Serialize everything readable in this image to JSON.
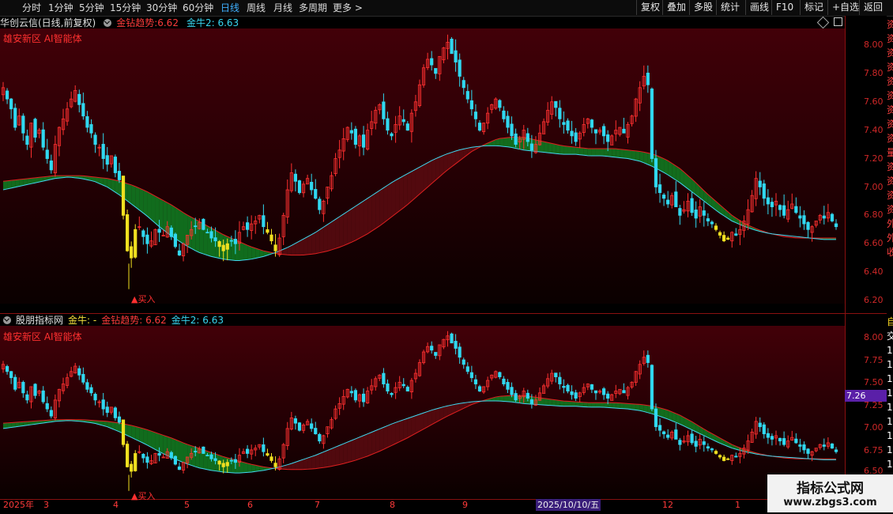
{
  "toolbar": {
    "periods": [
      "分时",
      "1分钟",
      "5分钟",
      "15分钟",
      "30分钟",
      "60分钟",
      "日线",
      "周线",
      "月线",
      "多周期",
      "更多 >"
    ],
    "active_period": "日线",
    "right_buttons": [
      "复权",
      "叠加",
      "多股",
      "统计",
      "画线",
      "F10",
      "标记",
      "+自选",
      "返回"
    ]
  },
  "panel1": {
    "stock": "华创云信(日线,前复权)",
    "ind_name": "金钻趋势:",
    "ind_value": "6.62",
    "ind2": "金牛2: 6.63",
    "tag": "雄安新区 AI智能体",
    "buy": "▲买入",
    "y_ticks": [
      "8.00",
      "7.80",
      "7.60",
      "7.40",
      "7.20",
      "7.00",
      "6.80",
      "6.60",
      "6.40",
      "6.20"
    ]
  },
  "panel2": {
    "source": "股朋指标网",
    "jn": "金牛: -",
    "ind": "金钻趋势: 6.62",
    "ind2": "金牛2: 6.63",
    "tag": "雄安新区 AI智能体",
    "buy": "▲买入",
    "y_ticks": [
      "8.00",
      "7.75",
      "7.50",
      "7.25",
      "7.00",
      "6.75",
      "6.50"
    ],
    "price_tag": "7.26"
  },
  "right_column": [
    "资",
    "资",
    "资",
    "资",
    "资",
    "资",
    "资",
    "资",
    "资",
    "量",
    "资",
    "资",
    "资",
    "资",
    "外",
    "外",
    "收"
  ],
  "right_column2": [
    "自",
    "交",
    "1",
    "1",
    "1",
    "1",
    "1",
    "1",
    "1",
    "1",
    "1",
    "1"
  ],
  "xaxis": [
    "2025年",
    "3",
    "4",
    "5",
    "6",
    "7",
    "8",
    "9",
    "2025/10/10/五",
    "12",
    "1"
  ],
  "watermark": {
    "title": "指标公式网",
    "url": "www.zbgs3.com"
  },
  "colors": {
    "up": "#ff3030",
    "down": "#30d8f0",
    "green": "#10a030",
    "yellow": "#f0e020",
    "bg_top": "#3c0008"
  },
  "chart_data": {
    "type": "candlestick",
    "ylim_top": [
      6.15,
      8.1
    ],
    "ylim_bottom": [
      6.45,
      8.1
    ],
    "closes": [
      7.7,
      7.62,
      7.55,
      7.42,
      7.5,
      7.38,
      7.3,
      7.45,
      7.35,
      7.4,
      7.28,
      7.2,
      7.12,
      7.3,
      7.42,
      7.48,
      7.55,
      7.62,
      7.68,
      7.58,
      7.5,
      7.42,
      7.38,
      7.3,
      7.28,
      7.2,
      7.16,
      7.22,
      7.1,
      7.05,
      6.8,
      6.55,
      6.5,
      6.7,
      6.72,
      6.65,
      6.6,
      6.62,
      6.7,
      6.68,
      6.66,
      6.72,
      6.65,
      6.58,
      6.52,
      6.6,
      6.66,
      6.7,
      6.72,
      6.75,
      6.7,
      6.68,
      6.64,
      6.62,
      6.58,
      6.55,
      6.6,
      6.62,
      6.6,
      6.68,
      6.72,
      6.7,
      6.74,
      6.76,
      6.8,
      6.72,
      6.68,
      6.62,
      6.55,
      6.64,
      6.8,
      6.98,
      7.1,
      7.04,
      6.96,
      7.02,
      7.06,
      6.98,
      6.92,
      6.84,
      6.9,
      7.0,
      7.08,
      7.2,
      7.26,
      7.34,
      7.42,
      7.38,
      7.3,
      7.36,
      7.28,
      7.4,
      7.46,
      7.54,
      7.58,
      7.48,
      7.4,
      7.36,
      7.44,
      7.5,
      7.46,
      7.4,
      7.52,
      7.6,
      7.72,
      7.84,
      7.9,
      7.86,
      7.8,
      7.92,
      7.98,
      8.02,
      7.94,
      7.88,
      7.78,
      7.7,
      7.62,
      7.55,
      7.48,
      7.4,
      7.45,
      7.52,
      7.58,
      7.62,
      7.56,
      7.48,
      7.42,
      7.36,
      7.3,
      7.34,
      7.4,
      7.32,
      7.26,
      7.3,
      7.38,
      7.46,
      7.54,
      7.6,
      7.56,
      7.48,
      7.44,
      7.4,
      7.36,
      7.32,
      7.38,
      7.44,
      7.48,
      7.42,
      7.38,
      7.4,
      7.36,
      7.32,
      7.36,
      7.4,
      7.42,
      7.38,
      7.44,
      7.5,
      7.62,
      7.7,
      7.78,
      7.72,
      7.2,
      7.0,
      6.96,
      6.92,
      6.88,
      6.94,
      6.86,
      6.8,
      6.84,
      6.9,
      6.82,
      6.78,
      6.86,
      6.8,
      6.76,
      6.74,
      6.7,
      6.66,
      6.62,
      6.64,
      6.68,
      6.66,
      6.7,
      6.76,
      6.84,
      6.94,
      7.06,
      7.0,
      6.92,
      6.88,
      6.86,
      6.9,
      6.84,
      6.8,
      6.84,
      6.88,
      6.82,
      6.78,
      6.74,
      6.7,
      6.72,
      6.76,
      6.8,
      6.78,
      6.82,
      6.76,
      6.72
    ],
    "trend_red": [
      7.04,
      7.05,
      7.06,
      7.07,
      7.08,
      7.08,
      7.08,
      7.07,
      7.06,
      7.04,
      7.01,
      6.97,
      6.92,
      6.87,
      6.81,
      6.76,
      6.71,
      6.66,
      6.62,
      6.58,
      6.55,
      6.53,
      6.52,
      6.52,
      6.53,
      6.55,
      6.58,
      6.62,
      6.67,
      6.73,
      6.8,
      6.87,
      6.95,
      7.03,
      7.11,
      7.18,
      7.25,
      7.3,
      7.34,
      7.35,
      7.35,
      7.33,
      7.31,
      7.29,
      7.28,
      7.27,
      7.27,
      7.27,
      7.26,
      7.25,
      7.23,
      7.19,
      7.13,
      7.05,
      6.96,
      6.88,
      6.8,
      6.74,
      6.7,
      6.67,
      6.65,
      6.64,
      6.64,
      6.64,
      6.64
    ],
    "trend_cyan": [
      6.98,
      7.0,
      7.02,
      7.04,
      7.06,
      7.07,
      7.06,
      7.04,
      7.0,
      6.94,
      6.87,
      6.8,
      6.72,
      6.65,
      6.59,
      6.54,
      6.51,
      6.49,
      6.48,
      6.49,
      6.51,
      6.54,
      6.58,
      6.63,
      6.68,
      6.74,
      6.8,
      6.86,
      6.92,
      6.98,
      7.04,
      7.09,
      7.14,
      7.19,
      7.23,
      7.26,
      7.28,
      7.29,
      7.29,
      7.28,
      7.26,
      7.25,
      7.24,
      7.23,
      7.23,
      7.22,
      7.22,
      7.21,
      7.2,
      7.18,
      7.14,
      7.09,
      7.03,
      6.96,
      6.89,
      6.82,
      6.76,
      6.72,
      6.69,
      6.67,
      6.66,
      6.65,
      6.64,
      6.63,
      6.63
    ]
  }
}
